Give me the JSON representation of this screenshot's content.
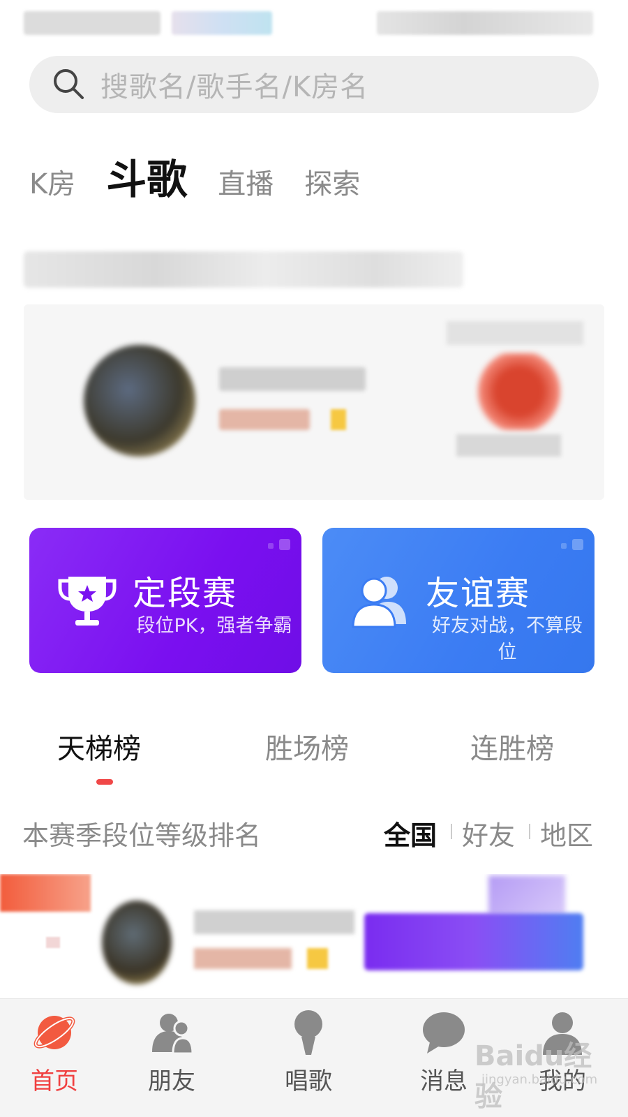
{
  "search": {
    "placeholder": "搜歌名/歌手名/K房名"
  },
  "top_tabs": [
    {
      "label": "K房",
      "active": false
    },
    {
      "label": "斗歌",
      "active": true
    },
    {
      "label": "直播",
      "active": false
    },
    {
      "label": "探索",
      "active": false
    }
  ],
  "modes": {
    "rank": {
      "title": "定段赛",
      "subtitle": "段位PK，强者争霸",
      "icon": "trophy-icon",
      "color_start": "#8a2cf6",
      "color_end": "#6f0ee6"
    },
    "friend": {
      "title": "友谊赛",
      "subtitle": "好友对战，不算段位",
      "icon": "users-icon",
      "color_start": "#4c8cf6",
      "color_end": "#3577ee"
    }
  },
  "rank_tabs": [
    {
      "label": "天梯榜",
      "active": true
    },
    {
      "label": "胜场榜",
      "active": false
    },
    {
      "label": "连胜榜",
      "active": false
    }
  ],
  "filter": {
    "label": "本赛季段位等级排名",
    "options": [
      {
        "label": "全国",
        "active": true
      },
      {
        "label": "好友",
        "active": false
      },
      {
        "label": "地区",
        "active": false
      }
    ]
  },
  "bottom_nav": [
    {
      "label": "首页",
      "icon": "planet-icon",
      "active": true
    },
    {
      "label": "朋友",
      "icon": "friends-icon",
      "active": false
    },
    {
      "label": "唱歌",
      "icon": "microphone-icon",
      "active": false
    },
    {
      "label": "消息",
      "icon": "chat-icon",
      "active": false
    },
    {
      "label": "我的",
      "icon": "profile-icon",
      "active": false
    }
  ],
  "watermark": {
    "text": "Baidu经验",
    "sub": "jingyan.baidu.com"
  },
  "colors": {
    "accent": "#f04848",
    "nav_active": "#f04040"
  }
}
